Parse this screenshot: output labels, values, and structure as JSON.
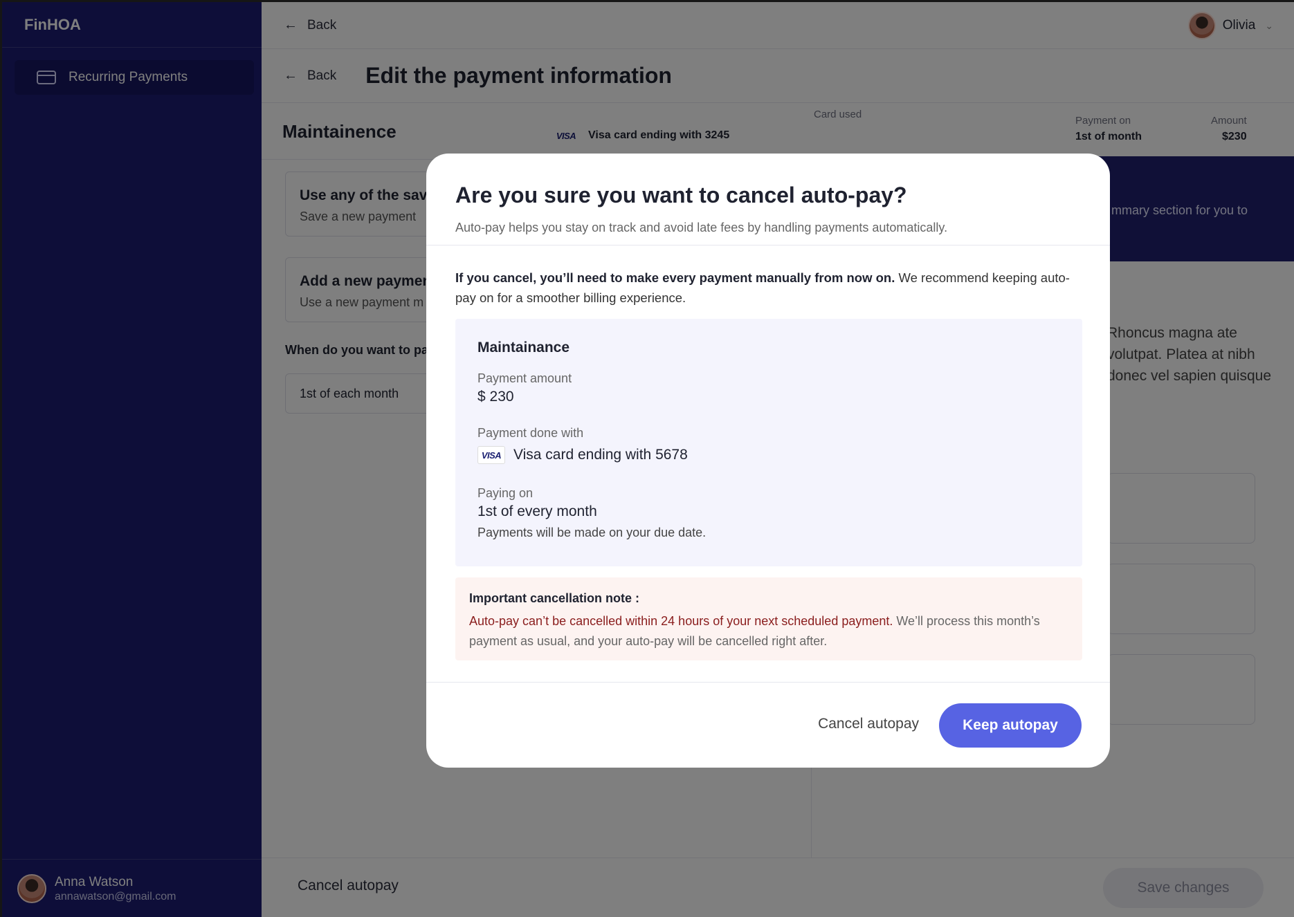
{
  "app": {
    "brand": "FinHOA"
  },
  "sidebar": {
    "items": [
      {
        "label": "Recurring Payments",
        "icon": "credit-card-icon"
      }
    ],
    "user": {
      "name": "Anna Watson",
      "email": "annawatson@gmail.com"
    }
  },
  "topbar": {
    "back_label": "Back",
    "user_name": "Olivia"
  },
  "page": {
    "back_label": "Back",
    "title": "Edit the payment information",
    "section_title": "Maintainence",
    "card_used_label": "Card used",
    "card_used_value": "Visa card ending with 3245",
    "payment_on_label": "Payment on",
    "payment_on_value": "1st of month",
    "amount_label": "Amount",
    "amount_value": "$230",
    "option1_title": "Use any of the sav",
    "option1_sub": "Save a new payment",
    "option2_title": "Add a new paymen",
    "option2_sub": "Use a new payment m",
    "when_label": "When do you want to pa",
    "when_value": "1st of each month",
    "banner_text": "mmary section for you to",
    "lorem": "Rhoncus magna ate volutpat. Platea at nibh donec vel sapien quisque"
  },
  "footer": {
    "cancel_label": "Cancel autopay",
    "save_label": "Save changes"
  },
  "modal": {
    "title": "Are you sure you want to cancel auto-pay?",
    "subtitle": "Auto-pay helps you stay on track and avoid late fees by handling payments automatically.",
    "warning_bold": "If you cancel, you’ll need to make every payment manually from now on.",
    "warning_rest": " We recommend keeping auto-pay on for a smoother billing experience.",
    "card": {
      "heading": "Maintainance",
      "amount_label": "Payment amount",
      "amount_value": "$ 230",
      "method_label": "Payment done with",
      "method_value": "Visa card ending with 5678",
      "paying_label": "Paying on",
      "paying_value": "1st of every month",
      "paying_note": "Payments will be made on your due date."
    },
    "alert": {
      "heading": "Important cancellation note :",
      "red_text": "Auto-pay can’t be cancelled within 24 hours of your next scheduled payment.",
      "rest_text": " We’ll process this month’s payment as usual, and your auto-pay will be cancelled right after."
    },
    "cancel_button": "Cancel autopay",
    "keep_button": "Keep autopay"
  },
  "visa_label": "VISA",
  "colors": {
    "sidebar": "#1c1c72",
    "primary": "#5763e3",
    "alert_red": "#8a1d1d"
  }
}
